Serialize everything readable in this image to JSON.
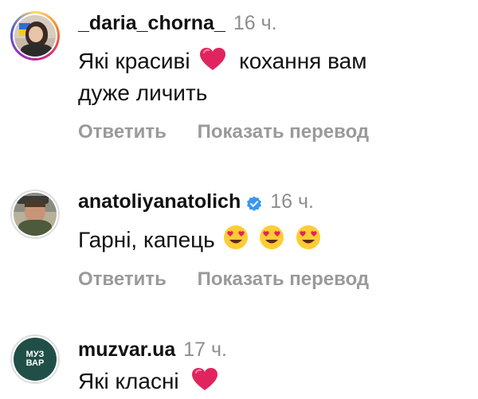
{
  "comments": [
    {
      "username": "_daria_chorna_",
      "time": "16 ч.",
      "text_line1": "Які красиві",
      "text_line1_after": "кохання вам",
      "text_line2": "дуже личить",
      "reply_label": "Ответить",
      "translate_label": "Показать перевод",
      "emojis": [
        "red-heart"
      ]
    },
    {
      "username": "anatoliyanatolich",
      "verified": true,
      "time": "16 ч.",
      "text_line1": "Гарні, капець",
      "reply_label": "Ответить",
      "translate_label": "Показать перевод",
      "emojis": [
        "heart-eyes",
        "heart-eyes",
        "heart-eyes"
      ]
    },
    {
      "username": "muzvar.ua",
      "time": "17 ч.",
      "text_line1": "Які класні",
      "avatar_text": "МУЗ ВАР",
      "emojis": [
        "red-heart"
      ]
    }
  ],
  "colors": {
    "secondary_text": "#8e8e8e",
    "action_text": "#9a9a9a",
    "verified_blue": "#3897f0",
    "heart_red": "#e0245e",
    "muzvar_bg": "#1f4f47"
  }
}
